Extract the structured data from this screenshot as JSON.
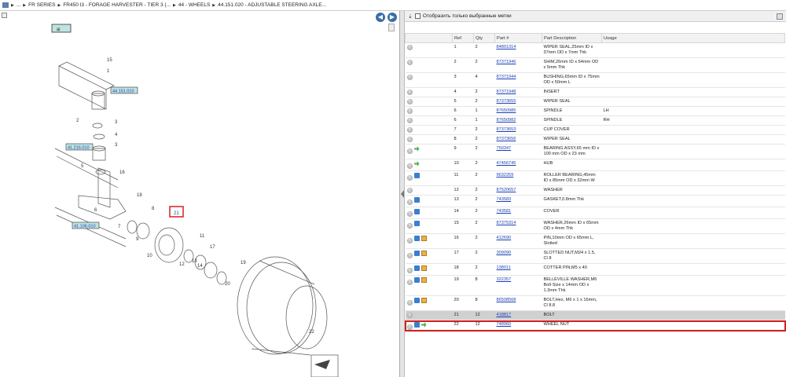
{
  "breadcrumb": {
    "items": [
      "...",
      "FR SERIES",
      "FR450 I3 - FORAGE HARVESTER - TIER 3 (...",
      "44 - WHEELS",
      "44.151.020 - ADJUSTABLE STEERING AXLE..."
    ]
  },
  "filter": {
    "label": "Отобразить только выбранные метки"
  },
  "diagram": {
    "callouts": [
      "44.151.010",
      "41.216.010",
      "41.106.010"
    ],
    "numbers": [
      "15",
      "1",
      "2",
      "3",
      "4",
      "3",
      "5",
      "16",
      "6",
      "18",
      "7",
      "8",
      "9",
      "21",
      "10",
      "11",
      "12",
      "13",
      "14",
      "17",
      "19",
      "20",
      "22"
    ]
  },
  "table": {
    "headers": [
      "Ref",
      "Qty",
      "Part #",
      "Part Description",
      "Usage"
    ],
    "rows": [
      {
        "ref": "1",
        "qty": "2",
        "part": "84801314",
        "desc": "WIPER SEAL,25mm ID x 37mm OD x 7mm Thk",
        "usage": "",
        "icons": []
      },
      {
        "ref": "2",
        "qty": "2",
        "part": "87371946",
        "desc": "SHIM,26mm ID x 64mm OD x 5mm Thk",
        "usage": "",
        "icons": []
      },
      {
        "ref": "3",
        "qty": "4",
        "part": "87371944",
        "desc": "BUSHING,65mm ID x 75mm OD x 50mm L",
        "usage": "",
        "icons": []
      },
      {
        "ref": "4",
        "qty": "2",
        "part": "87371948",
        "desc": "INSERT",
        "usage": "",
        "icons": []
      },
      {
        "ref": "5",
        "qty": "2",
        "part": "87373655",
        "desc": "WIPER SEAL",
        "usage": "",
        "icons": []
      },
      {
        "ref": "6",
        "qty": "1",
        "part": "87650985",
        "desc": "SPINDLE",
        "usage": "LH",
        "icons": []
      },
      {
        "ref": "6",
        "qty": "1",
        "part": "87650982",
        "desc": "SPINDLE",
        "usage": "RH",
        "icons": []
      },
      {
        "ref": "7",
        "qty": "2",
        "part": "87373653",
        "desc": "CUP COVER",
        "usage": "",
        "icons": []
      },
      {
        "ref": "8",
        "qty": "2",
        "part": "87373656",
        "desc": "WIPER SEAL",
        "usage": "",
        "icons": []
      },
      {
        "ref": "9",
        "qty": "2",
        "part": "750347",
        "desc": "BEARING ASSY,65 mm ID x 100 mm OD x 23 mm",
        "usage": "",
        "icons": [
          "green"
        ]
      },
      {
        "ref": "10",
        "qty": "2",
        "part": "47456745",
        "desc": "HUB",
        "usage": "",
        "icons": [
          "green"
        ]
      },
      {
        "ref": "11",
        "qty": "2",
        "part": "9632269",
        "desc": "ROLLER BEARING,45mm ID x 85mm OD x 32mm W",
        "usage": "",
        "icons": [
          "blue"
        ]
      },
      {
        "ref": "12",
        "qty": "2",
        "part": "87520657",
        "desc": "WASHER",
        "usage": "",
        "icons": []
      },
      {
        "ref": "13",
        "qty": "2",
        "part": "743583",
        "desc": "GASKET,0.8mm Thk",
        "usage": "",
        "icons": [
          "blue"
        ]
      },
      {
        "ref": "14",
        "qty": "2",
        "part": "743581",
        "desc": "COVER",
        "usage": "",
        "icons": [
          "blue"
        ]
      },
      {
        "ref": "15",
        "qty": "2",
        "part": "87375314",
        "desc": "WASHER,26mm ID x 65mm OD x 4mm Thk",
        "usage": "",
        "icons": [
          "blue"
        ]
      },
      {
        "ref": "16",
        "qty": "2",
        "part": "412690",
        "desc": "PIN,10mm OD x 65mm L, Slotted",
        "usage": "",
        "icons": [
          "blue",
          "box"
        ]
      },
      {
        "ref": "17",
        "qty": "2",
        "part": "309090",
        "desc": "SLOTTED NUT,M24 x 1.5, Cl 8",
        "usage": "",
        "icons": [
          "blue",
          "box"
        ]
      },
      {
        "ref": "18",
        "qty": "2",
        "part": "138011",
        "desc": "COTTER PIN,M5 x 40",
        "usage": "",
        "icons": [
          "blue",
          "box"
        ]
      },
      {
        "ref": "19",
        "qty": "8",
        "part": "322357",
        "desc": "BELLEVILLE WASHER,M6 Bolt Size x 14mm OD x 1.3mm Thk",
        "usage": "",
        "icons": [
          "blue",
          "box"
        ]
      },
      {
        "ref": "20",
        "qty": "8",
        "part": "86508568",
        "desc": "BOLT,Hex, M6 x 1 x 16mm, Cl 8.8",
        "usage": "",
        "icons": [
          "blue",
          "box"
        ]
      },
      {
        "ref": "21",
        "qty": "12",
        "part": "418817",
        "desc": "BOLT",
        "usage": "",
        "icons": [],
        "selected": true
      },
      {
        "ref": "22",
        "qty": "12",
        "part": "748960",
        "desc": "WHEEL NUT",
        "usage": "",
        "icons": [
          "blue",
          "green"
        ]
      }
    ]
  }
}
